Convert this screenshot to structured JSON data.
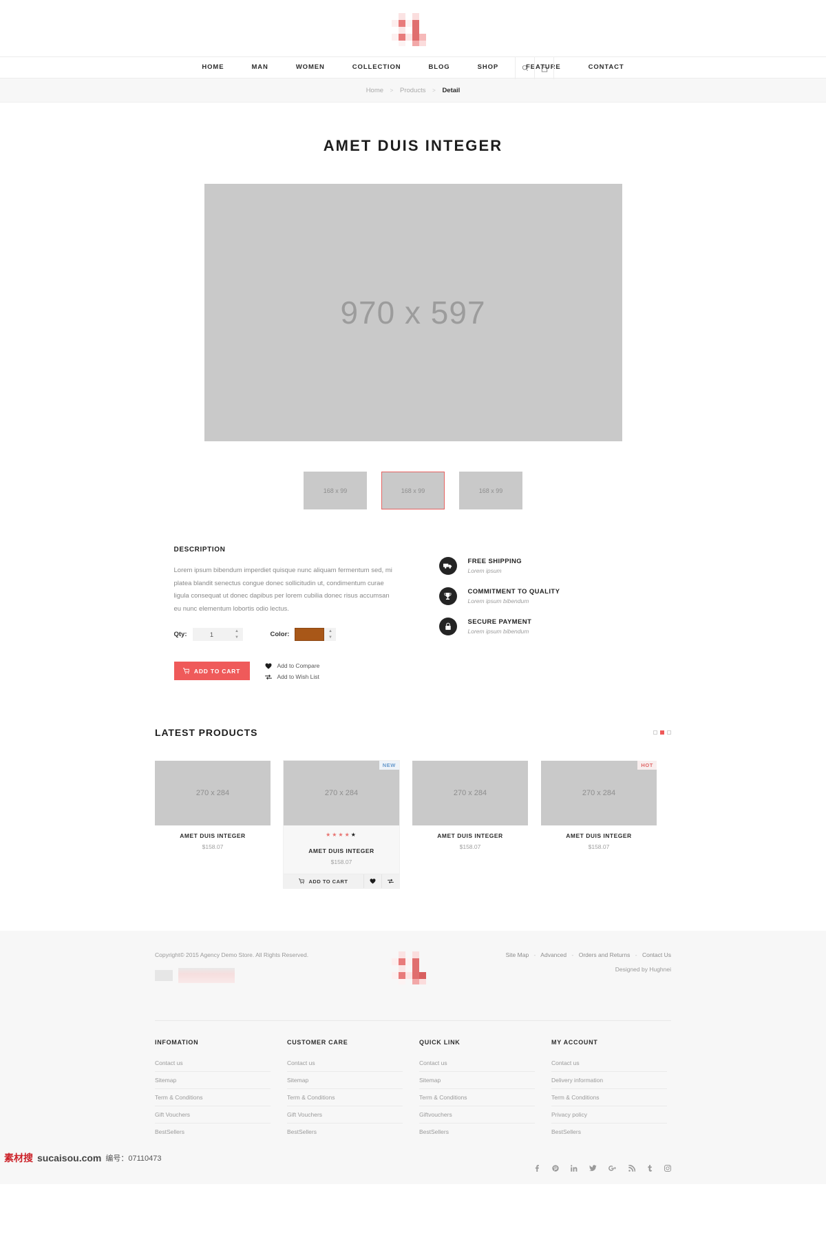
{
  "brand": {
    "logo_alt": "pixelated-logo",
    "accent": "#ef5a5a"
  },
  "nav": {
    "items": [
      {
        "label": "HOME"
      },
      {
        "label": "MAN"
      },
      {
        "label": "WOMEN"
      },
      {
        "label": "COLLECTION"
      },
      {
        "label": "BLOG"
      },
      {
        "label": "SHOP"
      },
      {
        "label": "FEATURE"
      },
      {
        "label": "CONTACT"
      }
    ],
    "search_icon": "search-icon",
    "cart_icon": "cart-icon"
  },
  "breadcrumb": {
    "home": "Home",
    "products": "Products",
    "current": "Detail",
    "separator": ">"
  },
  "product": {
    "title": "AMET DUIS INTEGER",
    "main_image_label": "970 x 597",
    "thumbs": [
      {
        "label": "168 x 99",
        "active": false
      },
      {
        "label": "168 x 99",
        "active": true
      },
      {
        "label": "168 x 99",
        "active": false
      }
    ],
    "description_heading": "DESCRIPTION",
    "description_text": "Lorem ipsum bibendum imperdiet quisque nunc aliquam fermentum sed, mi platea blandit senectus congue donec sollicitudin ut, condimentum curae ligula consequat ut donec dapibus per lorem cubilia donec risus accumsan eu nunc elementum lobortis odio lectus.",
    "qty_label": "Qty:",
    "qty_value": "1",
    "color_label": "Color:",
    "color_value": "#a85718",
    "add_to_cart": "ADD TO CART",
    "add_to_compare": "Add to Compare",
    "add_to_wishlist": "Add to Wish List"
  },
  "features": [
    {
      "title": "FREE SHIPPING",
      "sub": "Lorem ipsum",
      "icon": "truck-icon"
    },
    {
      "title": "COMMITMENT TO QUALITY",
      "sub": "Lorem ipsum bibendum",
      "icon": "trophy-icon"
    },
    {
      "title": "SECURE PAYMENT",
      "sub": "Lorem ipsum bibendum",
      "icon": "lock-icon"
    }
  ],
  "latest": {
    "title": "LATEST PRODUCTS",
    "dots": [
      false,
      true,
      false
    ],
    "products": [
      {
        "image_label": "270 x 284",
        "name": "AMET DUIS INTEGER",
        "price": "$158.07",
        "badge": "",
        "hovered": false,
        "rating": 0
      },
      {
        "image_label": "270 x 284",
        "name": "AMET DUIS INTEGER",
        "price": "$158.07",
        "badge": "NEW",
        "hovered": true,
        "rating": 4
      },
      {
        "image_label": "270 x 284",
        "name": "AMET DUIS INTEGER",
        "price": "$158.07",
        "badge": "",
        "hovered": false,
        "rating": 0
      },
      {
        "image_label": "270 x 284",
        "name": "AMET DUIS INTEGER",
        "price": "$158.07",
        "badge": "HOT",
        "hovered": false,
        "rating": 0
      }
    ],
    "card_add_to_cart": "ADD TO CART"
  },
  "footer": {
    "copyright": "Copyright© 2015 Agency Demo Store. All Rights Reserved.",
    "top_links": [
      {
        "label": "Site Map"
      },
      {
        "label": "Advanced"
      },
      {
        "label": "Orders and Returns"
      },
      {
        "label": "Contact Us"
      }
    ],
    "designed_by": "Designed by Hughnei",
    "columns": [
      {
        "title": "INFOMATION",
        "links": [
          "Contact us",
          "Sitemap",
          "Term & Conditions",
          "Gift Vouchers",
          "BestSellers"
        ]
      },
      {
        "title": "CUSTOMER CARE",
        "links": [
          "Contact us",
          "Sitemap",
          "Term & Conditions",
          "Gift Vouchers",
          "BestSellers"
        ]
      },
      {
        "title": "QUICK LINK",
        "links": [
          "Contact us",
          "Sitemap",
          "Term & Conditions",
          "Giftvouchers",
          "BestSellers"
        ]
      },
      {
        "title": "MY ACCOUNT",
        "links": [
          "Contact us",
          "Delivery information",
          "Term & Conditions",
          "Privacy policy",
          "BestSellers"
        ]
      }
    ],
    "social": [
      {
        "name": "facebook-icon"
      },
      {
        "name": "pinterest-icon"
      },
      {
        "name": "linkedin-icon"
      },
      {
        "name": "twitter-icon"
      },
      {
        "name": "google-plus-icon"
      },
      {
        "name": "rss-icon"
      },
      {
        "name": "tumblr-icon"
      },
      {
        "name": "instagram-icon"
      }
    ]
  },
  "watermark": {
    "site": "sucaisou.com",
    "prefix": "素材搜",
    "code": "编号：07110473"
  }
}
